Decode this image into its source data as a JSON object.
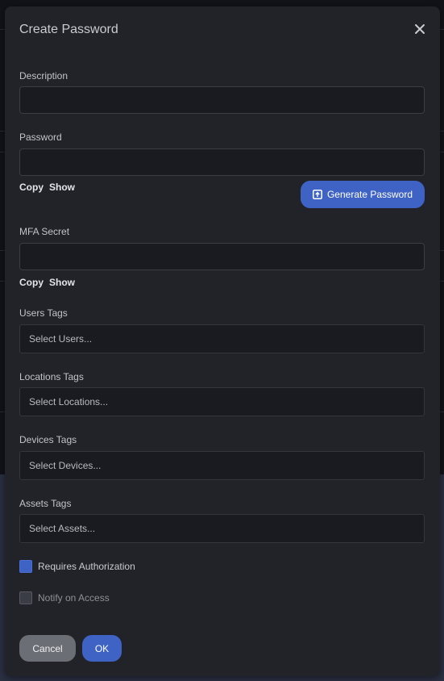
{
  "dialog": {
    "title": "Create Password",
    "close_icon": "close-icon"
  },
  "fields": {
    "description": {
      "label": "Description",
      "value": ""
    },
    "password": {
      "label": "Password",
      "value": "",
      "copy": "Copy",
      "show": "Show",
      "generate": "Generate Password",
      "generate_icon": "upload-icon"
    },
    "mfa": {
      "label": "MFA Secret",
      "value": "",
      "copy": "Copy",
      "show": "Show"
    }
  },
  "tags": {
    "users": {
      "label": "Users Tags",
      "placeholder": "Select Users..."
    },
    "locations": {
      "label": "Locations Tags",
      "placeholder": "Select Locations..."
    },
    "devices": {
      "label": "Devices Tags",
      "placeholder": "Select Devices..."
    },
    "assets": {
      "label": "Assets Tags",
      "placeholder": "Select Assets..."
    }
  },
  "options": {
    "requires_authorization": {
      "label": "Requires Authorization",
      "checked": true
    },
    "notify_on_access": {
      "label": "Notify on Access",
      "checked": false
    }
  },
  "footer": {
    "cancel": "Cancel",
    "ok": "OK"
  },
  "colors": {
    "accent": "#3e63c4",
    "modal_bg": "#222328"
  }
}
